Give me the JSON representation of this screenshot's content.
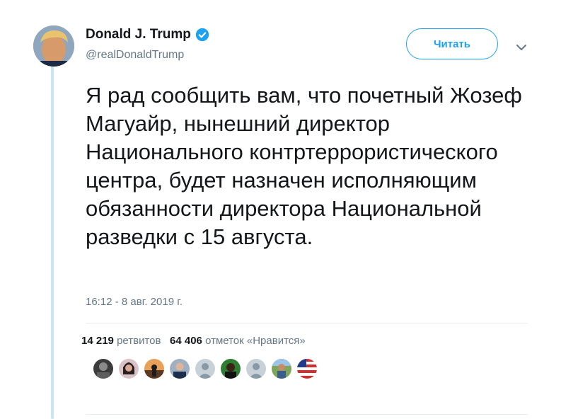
{
  "tweet": {
    "author_name": "Donald J. Trump",
    "author_handle": "@realDonaldTrump",
    "follow_label": "Читать",
    "text": "Я рад сообщить вам, что почетный Жозеф Магуайр, нынешний директор Национального контртеррористического центра, будет назначен исполняющим обязанности директора Национальной разведки с 15 августа.",
    "timestamp": "16:12 - 8 авг. 2019 г.",
    "retweets_count": "14 219",
    "retweets_label": "ретвитов",
    "likes_count": "64 406",
    "likes_label": "отметок «Нравится»"
  },
  "icons": {
    "verified": "verified-badge-icon",
    "more": "chevron-down-icon"
  },
  "colors": {
    "accent": "#1da1f2",
    "secondary_text": "#657786",
    "thread_line": "#c8e6f8"
  },
  "likers": [
    {
      "style": "dark-photo"
    },
    {
      "style": "woman-photo"
    },
    {
      "style": "silhouette-photo"
    },
    {
      "style": "man-photo"
    },
    {
      "style": "default-avatar"
    },
    {
      "style": "dark-green-photo"
    },
    {
      "style": "default-avatar"
    },
    {
      "style": "outdoor-photo"
    },
    {
      "style": "flag"
    }
  ]
}
